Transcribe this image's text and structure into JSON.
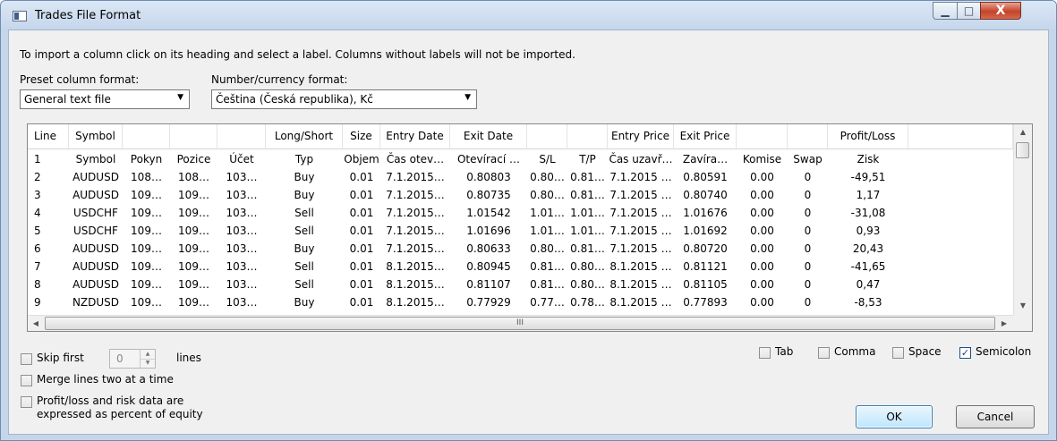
{
  "window": {
    "title": "Trades File Format",
    "minimize_glyph": "▁",
    "maximize_glyph": "□",
    "close_glyph": "X"
  },
  "instructions": "To import a column click on its heading and select a label. Columns without labels will not be imported.",
  "preset": {
    "label": "Preset column format:",
    "value": "General text file"
  },
  "number_format": {
    "label": "Number/currency format:",
    "value": "Čeština (Česká republika), Kč"
  },
  "table": {
    "headers": [
      "Line",
      "Symbol",
      "",
      "",
      "",
      "Long/Short",
      "Size",
      "Entry Date",
      "Exit Date",
      "",
      "",
      "Entry Price",
      "Exit Price",
      "",
      "",
      "Profit/Loss",
      ""
    ],
    "rows": [
      [
        "1",
        "Symbol",
        "Pokyn",
        "Pozice",
        "Účet",
        "Typ",
        "Objem",
        "Čas otev…",
        "Otevírací …",
        "S/L",
        "T/P",
        "Čas uzavř…",
        "Zavíra…",
        "Komise",
        "Swap",
        "Zisk"
      ],
      [
        "2",
        "AUDUSD",
        "108…",
        "108…",
        "103…",
        "Buy",
        "0.01",
        "7.1.2015…",
        "0.80803",
        "0.80…",
        "0.81…",
        "7.1.2015 …",
        "0.80591",
        "0.00",
        "0",
        "-49,51"
      ],
      [
        "3",
        "AUDUSD",
        "109…",
        "109…",
        "103…",
        "Buy",
        "0.01",
        "7.1.2015…",
        "0.80735",
        "0.80…",
        "0.81…",
        "7.1.2015 …",
        "0.80740",
        "0.00",
        "0",
        "1,17"
      ],
      [
        "4",
        "USDCHF",
        "109…",
        "109…",
        "103…",
        "Sell",
        "0.01",
        "7.1.2015…",
        "1.01542",
        "1.01…",
        "1.01…",
        "7.1.2015 …",
        "1.01676",
        "0.00",
        "0",
        "-31,08"
      ],
      [
        "5",
        "USDCHF",
        "109…",
        "109…",
        "103…",
        "Sell",
        "0.01",
        "7.1.2015…",
        "1.01696",
        "1.01…",
        "1.01…",
        "7.1.2015 …",
        "1.01692",
        "0.00",
        "0",
        "0,93"
      ],
      [
        "6",
        "AUDUSD",
        "109…",
        "109…",
        "103…",
        "Buy",
        "0.01",
        "7.1.2015…",
        "0.80633",
        "0.80…",
        "0.81…",
        "7.1.2015 …",
        "0.80720",
        "0.00",
        "0",
        "20,43"
      ],
      [
        "7",
        "AUDUSD",
        "109…",
        "109…",
        "103…",
        "Sell",
        "0.01",
        "8.1.2015…",
        "0.80945",
        "0.81…",
        "0.80…",
        "8.1.2015 …",
        "0.81121",
        "0.00",
        "0",
        "-41,65"
      ],
      [
        "8",
        "AUDUSD",
        "109…",
        "109…",
        "103…",
        "Sell",
        "0.01",
        "8.1.2015…",
        "0.81107",
        "0.81…",
        "0.80…",
        "8.1.2015 …",
        "0.81105",
        "0.00",
        "0",
        "0,47"
      ],
      [
        "9",
        "NZDUSD",
        "109…",
        "109…",
        "103…",
        "Buy",
        "0.01",
        "8.1.2015…",
        "0.77929",
        "0.77…",
        "0.78…",
        "8.1.2015 …",
        "0.77893",
        "0.00",
        "0",
        "-8,53"
      ]
    ]
  },
  "scroll_glyphs": {
    "up": "▲",
    "down": "▼",
    "left": "◀",
    "right": "▶",
    "grip": "III",
    "combo_arrow": "▼",
    "spin_up": "▲",
    "spin_down": "▼"
  },
  "options": {
    "skip_first": {
      "label": "Skip first",
      "value": "0",
      "suffix": "lines",
      "checked": false
    },
    "merge_lines": {
      "label": "Merge lines two at a time",
      "checked": false
    },
    "percent_equity": {
      "label_line1": "Profit/loss and risk data are",
      "label_line2": "expressed as percent of equity",
      "checked": false
    }
  },
  "delimiters": [
    {
      "label": "Tab",
      "checked": false
    },
    {
      "label": "Comma",
      "checked": false
    },
    {
      "label": "Space",
      "checked": false
    },
    {
      "label": "Semicolon",
      "checked": true
    }
  ],
  "check_glyph": "✓",
  "buttons": {
    "ok": "OK",
    "cancel": "Cancel"
  }
}
